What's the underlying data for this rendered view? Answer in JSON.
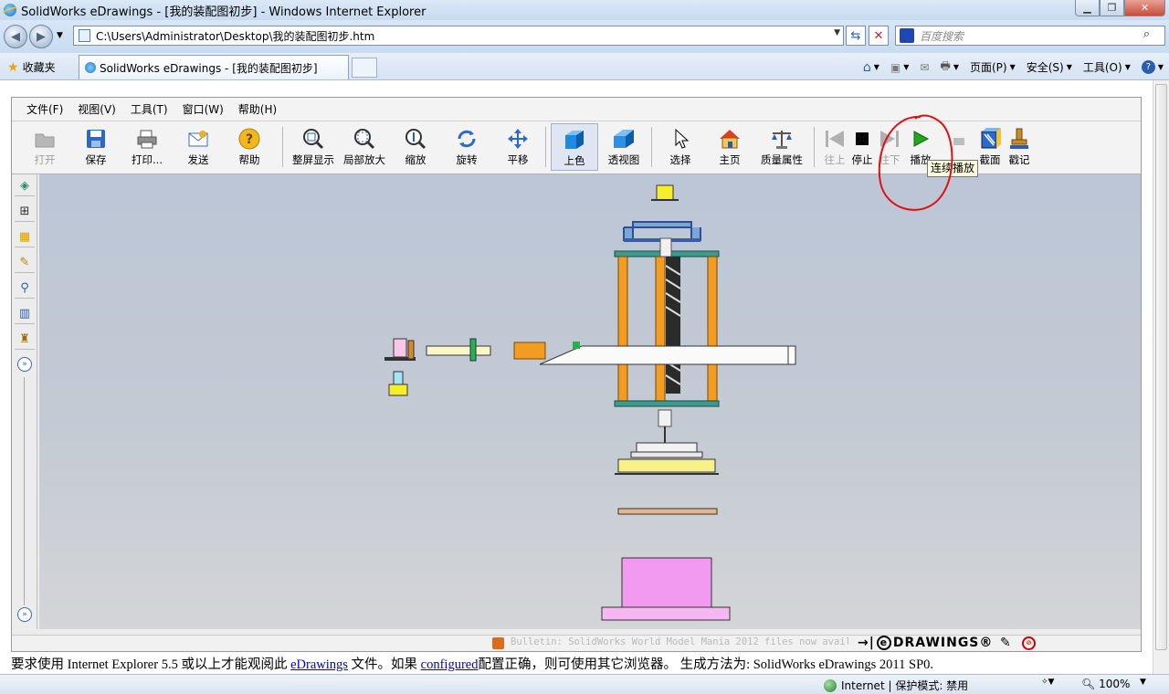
{
  "window": {
    "title": "SolidWorks eDrawings - [我的装配图初步] - Windows Internet Explorer"
  },
  "address": {
    "url": "C:\\Users\\Administrator\\Desktop\\我的装配图初步.htm"
  },
  "search": {
    "placeholder": "百度搜索"
  },
  "favorites": {
    "label": "收藏夹"
  },
  "tab": {
    "title": "SolidWorks eDrawings - [我的装配图初步]"
  },
  "command_bar": {
    "page": "页面(P)",
    "safety": "安全(S)",
    "tools": "工具(O)"
  },
  "menu": [
    "文件(F)",
    "视图(V)",
    "工具(T)",
    "窗口(W)",
    "帮助(H)"
  ],
  "toolbar": {
    "open": "打开",
    "save": "保存",
    "print": "打印...",
    "send": "发送",
    "help": "帮助",
    "fit": "整屏显示",
    "zoom_area": "局部放大",
    "zoom": "缩放",
    "rotate": "旋转",
    "pan": "平移",
    "shaded": "上色",
    "perspective": "透视图",
    "select": "选择",
    "home": "主页",
    "mass_props": "质量属性",
    "prev": "往上",
    "stop": "停止",
    "next": "往下",
    "play": "播放",
    "section": "截面",
    "stamp": "戳记"
  },
  "tooltip": "连续播放",
  "bulletin": "Bulletin: SolidWorks World Model Mania 2012 files now avail...",
  "brand": "DRAWINGS®",
  "info": {
    "prefix": "要求使用 Internet Explorer 5.5 或以上才能观阅此",
    "link1": "eDrawings",
    "mid": "文件。如果",
    "link2": "configured",
    "suffix": "配置正确，则可使用其它浏览器。 生成方法为: SolidWorks eDrawings 2011 SP0."
  },
  "status": {
    "zone": "Internet | 保护模式: 禁用",
    "zoom": "100%"
  }
}
